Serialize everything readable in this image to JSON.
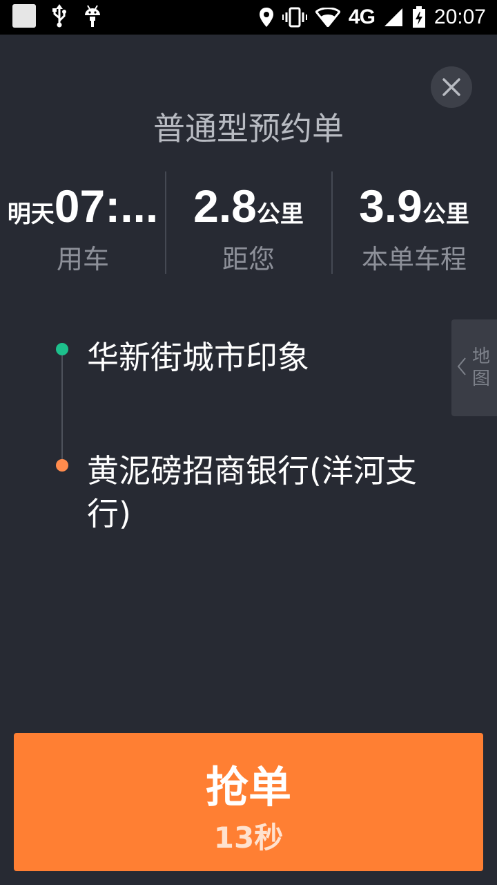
{
  "status_bar": {
    "network": "4G",
    "time": "20:07",
    "icons": [
      "app-notification-icon",
      "usb-icon",
      "android-debug-icon",
      "location-icon",
      "vibrate-icon",
      "wifi-icon",
      "signal-icon",
      "battery-charging-icon"
    ]
  },
  "order": {
    "title": "普通型预约单",
    "close_icon": "close-icon"
  },
  "stats": {
    "time": {
      "prefix": "明天",
      "value": "07:...",
      "label": "用车"
    },
    "distance": {
      "value": "2.8",
      "unit": "公里",
      "label": "距您"
    },
    "trip": {
      "value": "3.9",
      "unit": "公里",
      "label": "本单车程"
    }
  },
  "route": {
    "start": "华新街城市印象",
    "end": "黄泥磅招商银行(洋河支行)",
    "start_color": "#1dc08c",
    "end_color": "#ff8b4d"
  },
  "map_tab": {
    "label": "地图"
  },
  "grab_button": {
    "label": "抢单",
    "countdown": "13秒",
    "color": "#ff7f33"
  }
}
